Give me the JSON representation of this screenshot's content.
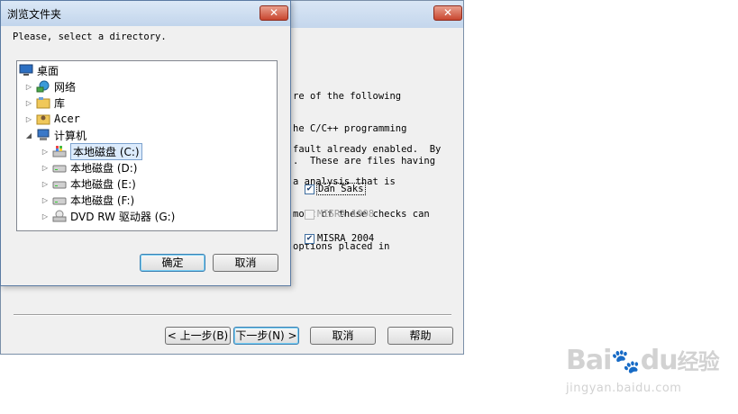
{
  "wizard": {
    "close_glyph": "✕",
    "para1": [
      "re of the following",
      "he C/C++ programming",
      ".  These are files having"
    ],
    "para2": [
      "fault already enabled.  By",
      "a analysis that is",
      "most of these checks can",
      "options placed in"
    ],
    "checks": [
      {
        "label": "Dan Saks",
        "checked": true,
        "enabled": true
      },
      {
        "label": "MISRA 1998",
        "checked": false,
        "enabled": false
      },
      {
        "label": "MISRA 2004",
        "checked": true,
        "enabled": true
      }
    ],
    "buttons": {
      "back": "< 上一步(B)",
      "next": "下一步(N) >",
      "cancel": "取消",
      "help": "帮助"
    }
  },
  "dialog": {
    "title": "浏览文件夹",
    "close_glyph": "✕",
    "prompt": "Please, select a directory.",
    "tree": [
      {
        "label": "桌面",
        "icon": "desktop-icon",
        "arrow": ""
      },
      {
        "label": "网络",
        "icon": "network-icon",
        "arrow": "▷"
      },
      {
        "label": "库",
        "icon": "library-icon",
        "arrow": "▷"
      },
      {
        "label": "Acer",
        "icon": "user-folder-icon",
        "arrow": "▷"
      },
      {
        "label": "计算机",
        "icon": "computer-icon",
        "arrow": "◢"
      },
      {
        "label": "本地磁盘 (C:)",
        "icon": "system-drive-icon",
        "arrow": "▷",
        "selected": true
      },
      {
        "label": "本地磁盘 (D:)",
        "icon": "drive-icon",
        "arrow": "▷"
      },
      {
        "label": "本地磁盘 (E:)",
        "icon": "drive-icon",
        "arrow": "▷"
      },
      {
        "label": "本地磁盘 (F:)",
        "icon": "drive-icon",
        "arrow": "▷"
      },
      {
        "label": "DVD RW 驱动器 (G:)",
        "icon": "dvd-drive-icon",
        "arrow": "▷"
      }
    ],
    "ok": "确定",
    "cancel": "取消"
  },
  "watermark": {
    "brand_a": "Bai",
    "brand_b": "du",
    "brand_c": "经验",
    "sub": "jingyan.baidu.com"
  }
}
